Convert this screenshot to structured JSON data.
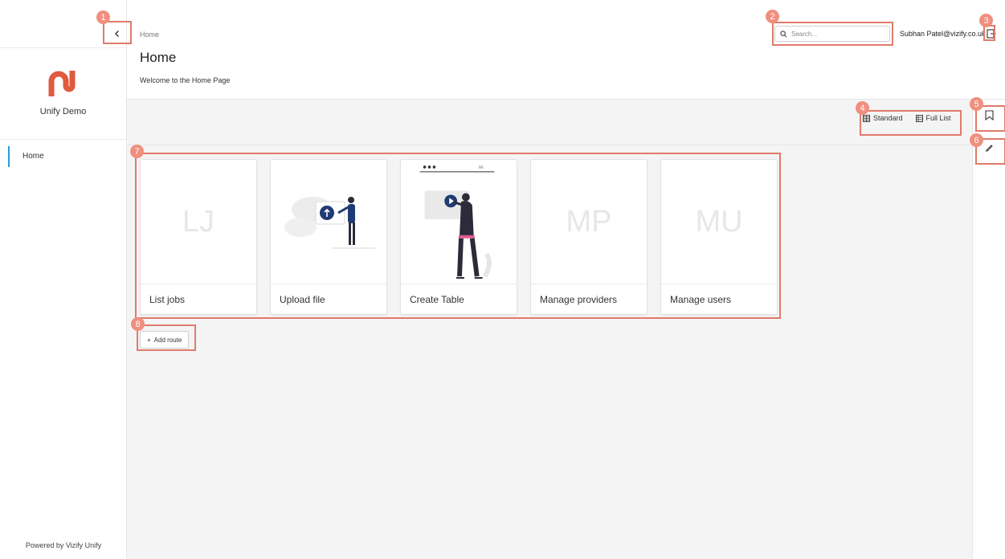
{
  "sidebar": {
    "brand_name": "Unify Demo",
    "nav_items": [
      {
        "label": "Home"
      }
    ],
    "footer": "Powered by Vizify Unify",
    "collapse_icon": "chevron-left-icon"
  },
  "header": {
    "breadcrumb": "Home",
    "title": "Home",
    "subtitle": "Welcome to the Home Page",
    "search_placeholder": "Search...",
    "user_email": "Subhan Patel@vizify.co.uk",
    "logout_icon": "logout-icon"
  },
  "toolbar": {
    "view_options": [
      {
        "label": "Standard",
        "icon": "grid-icon"
      },
      {
        "label": "Full List",
        "icon": "list-icon"
      }
    ]
  },
  "right_rail": {
    "buttons": [
      {
        "icon": "bookmark-icon"
      },
      {
        "icon": "pencil-icon"
      }
    ]
  },
  "cards": [
    {
      "initials": "LJ",
      "label": "List jobs"
    },
    {
      "initials": "",
      "label": "Upload file"
    },
    {
      "initials": "",
      "label": "Create Table"
    },
    {
      "initials": "MP",
      "label": "Manage providers"
    },
    {
      "initials": "MU",
      "label": "Manage users"
    }
  ],
  "add_route_label": "Add route",
  "annotations": [
    "1",
    "2",
    "3",
    "4",
    "5",
    "6",
    "7",
    "8"
  ],
  "colors": {
    "brand": "#e05a3f",
    "accent": "#2a9fd6",
    "annotation": "#e07b6a",
    "illustration_blue": "#1f3b73"
  }
}
